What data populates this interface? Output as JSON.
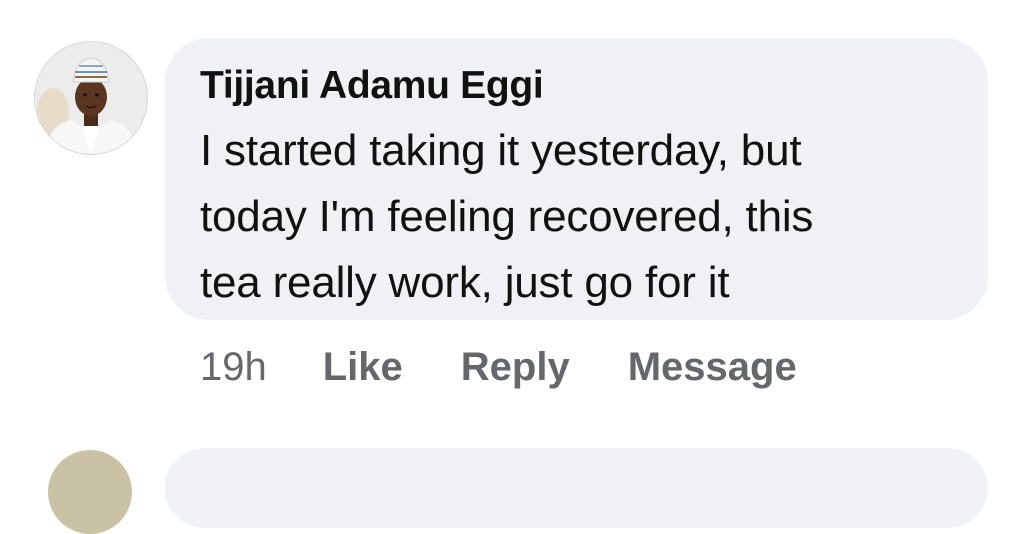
{
  "comment": {
    "author": "Tijjani Adamu Eggi",
    "text": "I started taking it yesterday, but\ntoday I'm feeling recovered, this\ntea really work, just go for it",
    "timestamp": "19h",
    "actions": {
      "like": "Like",
      "reply": "Reply",
      "message": "Message"
    }
  },
  "colors": {
    "bubble_background": "#eff1f4",
    "action_text": "#65676b",
    "primary_text": "#111111"
  }
}
